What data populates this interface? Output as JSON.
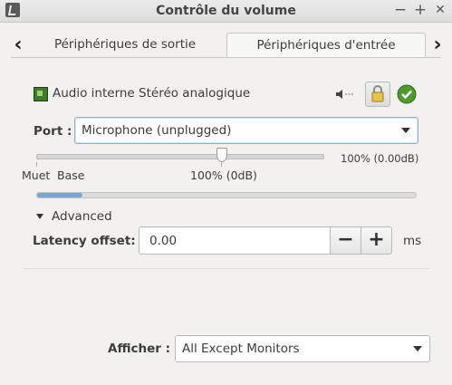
{
  "window": {
    "title": "Contrôle du volume",
    "controls": {
      "minimize": "−",
      "maximize": "+",
      "close": "✕"
    }
  },
  "tabs": [
    {
      "label": "Périphériques de sortie",
      "active": false
    },
    {
      "label": "Périphériques d'entrée",
      "active": true
    }
  ],
  "device": {
    "name": "Audio interne Stéréo analogique",
    "port_label": "Port :",
    "port_value": "Microphone (unplugged)",
    "volume_readout": "100% (0.00dB)",
    "volume_marks": [
      "Muet",
      "Base",
      "100% (0dB)"
    ],
    "volume_fraction": 0.66,
    "peak_level_fraction": 0.12,
    "advanced_label": "Advanced",
    "latency_label": "Latency offset:",
    "latency_value": "0.00",
    "latency_unit": "ms",
    "minus": "−",
    "plus": "+"
  },
  "footer": {
    "show_label": "Afficher :",
    "show_value": "All Except Monitors"
  },
  "icons": {
    "tab_prev": "chevron-left-icon",
    "tab_next": "chevron-right-icon",
    "device": "sound-card-icon",
    "mute": "speaker-icon",
    "lock": "lock-icon",
    "fallback": "check-icon"
  }
}
